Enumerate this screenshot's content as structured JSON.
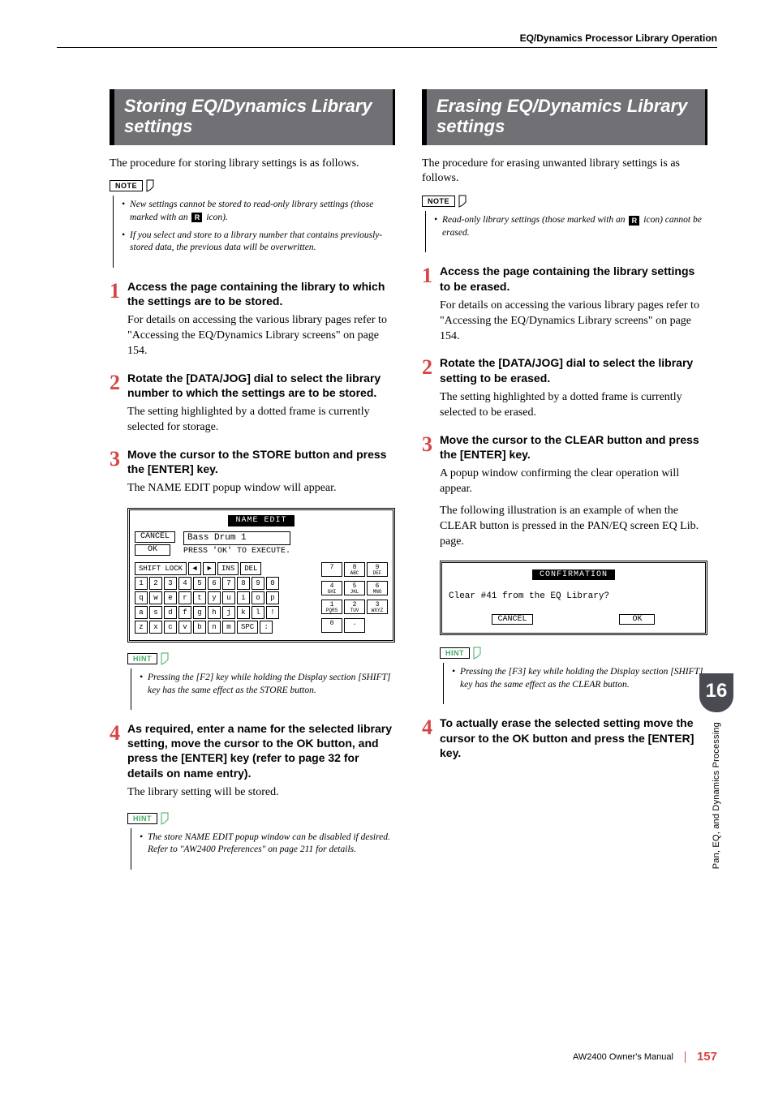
{
  "header": {
    "category": "EQ/Dynamics Processor Library Operation"
  },
  "left": {
    "heading": "Storing EQ/Dynamics Library settings",
    "intro": "The procedure for storing library settings is as follows.",
    "note_label": "NOTE",
    "notes": [
      "New settings cannot be stored to read-only library settings (those marked with an R icon).",
      "If you select and store to a library number that contains previously-stored data, the previous data will be overwritten."
    ],
    "steps": [
      {
        "num": "1",
        "title": "Access the page containing the library to which the settings are to be stored.",
        "body": "For details on accessing the various library pages refer to \"Accessing the EQ/Dynamics Library screens\" on page 154."
      },
      {
        "num": "2",
        "title": "Rotate the [DATA/JOG] dial to select the library number to which the settings are to be stored.",
        "body": "The setting highlighted by a dotted frame is currently selected for storage."
      },
      {
        "num": "3",
        "title": "Move the cursor to the STORE button and press the [ENTER] key.",
        "body": "The NAME EDIT popup window will appear."
      },
      {
        "num": "4",
        "title": "As required, enter a name for the selected library setting, move the cursor to the OK button, and press the [ENTER] key (refer to page 32 for details on name entry).",
        "body": "The library setting will be stored."
      }
    ],
    "screen": {
      "title": "NAME EDIT",
      "cancel": "CANCEL",
      "ok": "OK",
      "field_value": "Bass Drum 1",
      "instruction": "PRESS 'OK' TO EXECUTE.",
      "shift_lock": "SHIFT LOCK",
      "ins": "INS",
      "del": "DEL",
      "spc": "SPC",
      "row_num": [
        "1",
        "2",
        "3",
        "4",
        "5",
        "6",
        "7",
        "8",
        "9",
        "0"
      ],
      "row_q": [
        "q",
        "w",
        "e",
        "r",
        "t",
        "y",
        "u",
        "i",
        "o",
        "p"
      ],
      "row_a": [
        "a",
        "s",
        "d",
        "f",
        "g",
        "h",
        "j",
        "k",
        "l",
        "!"
      ],
      "row_z": [
        "z",
        "x",
        "c",
        "v",
        "b",
        "n",
        "m"
      ],
      "numpad": [
        {
          "t": "7",
          "b": ""
        },
        {
          "t": "8",
          "b": "ABC"
        },
        {
          "t": "9",
          "b": "DEF"
        },
        {
          "t": "4",
          "b": "GHI"
        },
        {
          "t": "5",
          "b": "JKL"
        },
        {
          "t": "6",
          "b": "MNO"
        },
        {
          "t": "1",
          "b": "PQRS"
        },
        {
          "t": "2",
          "b": "TUV"
        },
        {
          "t": "3",
          "b": "WXYZ"
        },
        {
          "t": "0",
          "b": ""
        },
        {
          "t": ".",
          "b": ""
        }
      ]
    },
    "hint1_label": "HINT",
    "hint1": "Pressing the [F2] key while holding the Display section [SHIFT] key has the same effect as the STORE button.",
    "hint2_label": "HINT",
    "hint2": "The store NAME EDIT popup window can be disabled if desired. Refer to \"AW2400 Preferences\" on page 211 for details."
  },
  "right": {
    "heading": "Erasing EQ/Dynamics Library settings",
    "intro": "The procedure for erasing unwanted library settings is as follows.",
    "note_label": "NOTE",
    "notes": [
      "Read-only library settings (those marked with an R icon) cannot be erased."
    ],
    "steps": [
      {
        "num": "1",
        "title": "Access the page containing the library settings to be erased.",
        "body": "For details on accessing the various library pages refer to \"Accessing the EQ/Dynamics Library screens\" on page 154."
      },
      {
        "num": "2",
        "title": "Rotate the [DATA/JOG] dial to select the library setting to be erased.",
        "body": "The setting highlighted by a dotted frame is currently selected to be erased."
      },
      {
        "num": "3",
        "title": "Move the cursor to the CLEAR button and press the [ENTER] key.",
        "body": "A popup window confirming the clear operation will appear.",
        "body2": "The following illustration is an example of when the CLEAR button is pressed in the PAN/EQ screen EQ Lib. page."
      },
      {
        "num": "4",
        "title": "To actually erase the selected setting move the cursor to the OK button and press the [ENTER] key."
      }
    ],
    "confirm": {
      "title": "CONFIRMATION",
      "message": "Clear #41 from the EQ Library?",
      "cancel": "CANCEL",
      "ok": "OK"
    },
    "hint_label": "HINT",
    "hint": "Pressing the [F3] key while holding the Display section [SHIFT] key has the same effect as the CLEAR button."
  },
  "side": {
    "chapter_num": "16",
    "chapter_title": "Pan, EQ, and Dynamics Processing"
  },
  "footer": {
    "manual": "AW2400  Owner's Manual",
    "page": "157"
  }
}
